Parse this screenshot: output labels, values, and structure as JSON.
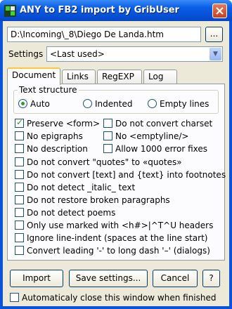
{
  "window": {
    "title": "ANY to FB2 import by GribUser"
  },
  "path": {
    "value": "D:\\Incoming\\_8\\Diego De Landa.htm",
    "browse_label": "..."
  },
  "settings": {
    "label": "Settings",
    "value": "<Last used>"
  },
  "tabs": [
    {
      "label": "Document",
      "active": true
    },
    {
      "label": "Links",
      "active": false
    },
    {
      "label": "RegEXP",
      "active": false
    },
    {
      "label": "Log",
      "active": false
    }
  ],
  "text_structure": {
    "legend": "Text structure",
    "options": [
      {
        "label": "Auto",
        "selected": true
      },
      {
        "label": "Indented",
        "selected": false
      },
      {
        "label": "Empty lines",
        "selected": false
      }
    ]
  },
  "options": {
    "preserve_form": {
      "label": "Preserve <form>",
      "checked": true
    },
    "no_convert_charset": {
      "label": "Do not convert charset",
      "checked": false
    },
    "no_epigraphs": {
      "label": "No epigraphs",
      "checked": false
    },
    "no_emptyline": {
      "label": "No <emptyline/>",
      "checked": false
    },
    "no_description": {
      "label": "No description",
      "checked": false
    },
    "allow_errors": {
      "label": "Allow 1000 error fixes",
      "checked": false
    },
    "no_quotes": {
      "label": "Do not convert \"quotes\" to «quotes»",
      "checked": false
    },
    "no_footnotes": {
      "label": "Do not convert [text] and {text} into footnotes",
      "checked": false
    },
    "no_italic": {
      "label": "Do not detect _italic_ text",
      "checked": false
    },
    "no_restore": {
      "label": "Do not restore broken paragraphs",
      "checked": false
    },
    "no_poems": {
      "label": "Do not detect poems",
      "checked": false
    },
    "only_marked": {
      "label": "Only use marked with <h#>|^T^U headers",
      "checked": false
    },
    "ignore_indent": {
      "label": "Ignore line-indent (spaces at the line start)",
      "checked": false
    },
    "long_dash": {
      "label": "Convert leading '-' to long dash '–' (dialogs)",
      "checked": false
    }
  },
  "buttons": {
    "import": "Import",
    "save_settings": "Save settings...",
    "cancel": "Cancel",
    "help": "?"
  },
  "auto_close": {
    "label": "Automaticaly close this window when finished",
    "checked": false
  }
}
